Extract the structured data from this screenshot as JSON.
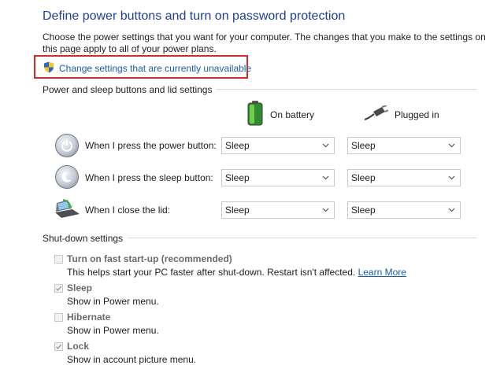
{
  "header": {
    "title": "Define power buttons and turn on password protection",
    "description": "Choose the power settings that you want for your computer. The changes that you make to the settings on this page apply to all of your power plans.",
    "change_settings_label": "Change settings that are currently unavailable"
  },
  "power_section": {
    "label": "Power and sleep buttons and lid settings",
    "columns": {
      "on_battery": "On battery",
      "plugged_in": "Plugged in"
    },
    "rows": [
      {
        "label": "When I press the power button:",
        "on_battery": "Sleep",
        "plugged_in": "Sleep"
      },
      {
        "label": "When I press the sleep button:",
        "on_battery": "Sleep",
        "plugged_in": "Sleep"
      },
      {
        "label": "When I close the lid:",
        "on_battery": "Sleep",
        "plugged_in": "Sleep"
      }
    ]
  },
  "shutdown_section": {
    "label": "Shut-down settings",
    "items": [
      {
        "label": "Turn on fast start-up (recommended)",
        "checked": false,
        "description": "This helps start your PC faster after shut-down. Restart isn't affected.",
        "link": "Learn More"
      },
      {
        "label": "Sleep",
        "checked": true,
        "description": "Show in Power menu."
      },
      {
        "label": "Hibernate",
        "checked": false,
        "description": "Show in Power menu."
      },
      {
        "label": "Lock",
        "checked": true,
        "description": "Show in account picture menu."
      }
    ]
  },
  "colors": {
    "title": "#1f3f98",
    "link": "#1a5ea8",
    "highlight_border": "#d02b2b"
  }
}
